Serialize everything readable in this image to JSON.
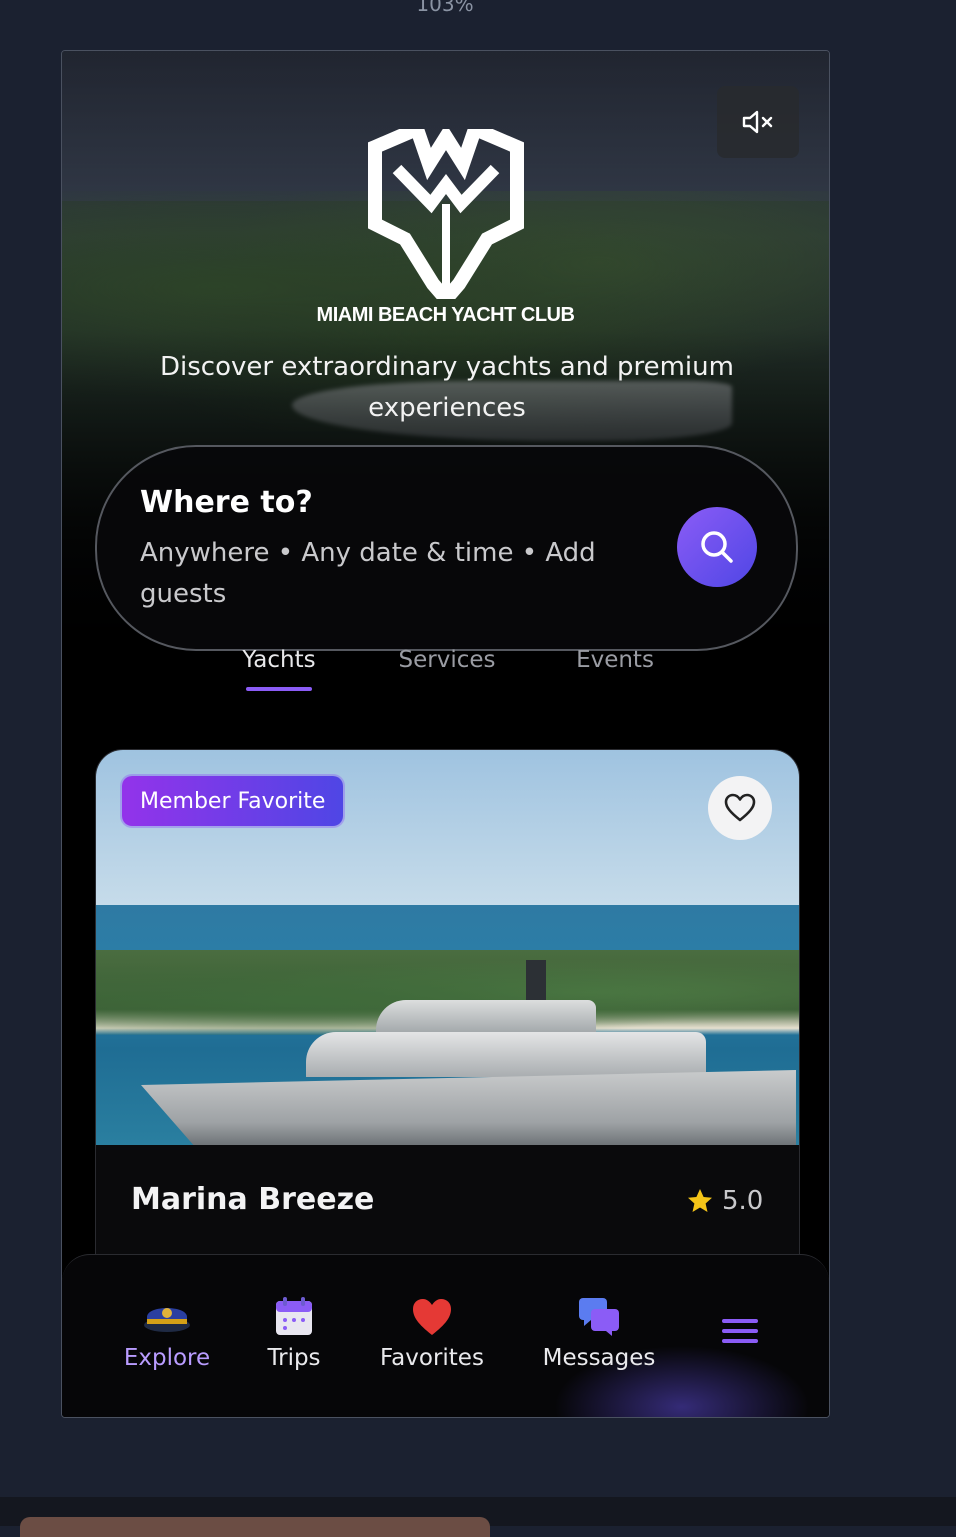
{
  "browser": {
    "zoom": "103%"
  },
  "hero": {
    "brand_name": "MIAMI BEACH YACHT CLUB",
    "tagline": "Discover extraordinary yachts and premium experiences",
    "mute_icon": "speaker-muted-icon"
  },
  "search": {
    "title": "Where to?",
    "subtitle": "Anywhere • Any date & time • Add guests",
    "button_icon": "search-icon"
  },
  "tabs": [
    {
      "label": "Yachts",
      "active": true
    },
    {
      "label": "Services",
      "active": false
    },
    {
      "label": "Events",
      "active": false
    }
  ],
  "listing": {
    "badge": "Member Favorite",
    "name": "Marina Breeze",
    "rating": "5.0",
    "favorite_icon": "heart-outline-icon",
    "rating_icon": "star-icon"
  },
  "bottom_nav": {
    "items": [
      {
        "label": "Explore",
        "icon": "captain-hat-icon",
        "active": true
      },
      {
        "label": "Trips",
        "icon": "calendar-icon",
        "active": false
      },
      {
        "label": "Favorites",
        "icon": "heart-icon",
        "active": false
      },
      {
        "label": "Messages",
        "icon": "chat-bubbles-icon",
        "active": false
      },
      {
        "label": "",
        "icon": "menu-icon",
        "active": false
      }
    ]
  },
  "colors": {
    "accent": "#8b5cf6",
    "accent_dark": "#4f46e5",
    "active_nav": "#b99cff",
    "background": "#000000"
  }
}
